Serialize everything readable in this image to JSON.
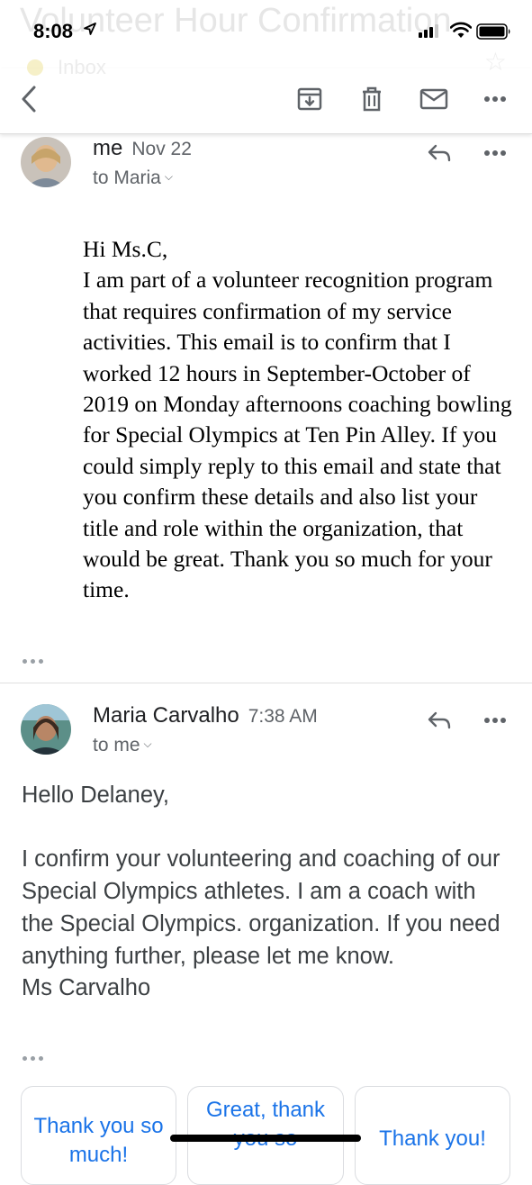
{
  "background_subject": "Volunteer Hour Confirmation",
  "background_label": "Inbox",
  "status_bar": {
    "time": "8:08"
  },
  "toolbar": {
    "back_icon": "back-arrow-icon",
    "archive_icon": "archive-icon",
    "delete_icon": "trash-icon",
    "mark_unread_icon": "mail-icon",
    "more_icon": "more-horizontal-icon"
  },
  "messages": [
    {
      "sender": "me",
      "date": "Nov 22",
      "to": "to Maria",
      "body": "Hi Ms.C,\nI am part of a volunteer recognition program that requires confirmation of my service activities. This email is to confirm that I worked 12 hours in September-October of 2019 on Monday afternoons coaching bowling for Special Olympics at Ten Pin Alley. If you could simply reply to this email and state that you confirm these details and also list your title and role within the organization, that would be great. Thank you so much for your time."
    },
    {
      "sender": "Maria Carvalho",
      "date": "7:38 AM",
      "to": "to me",
      "body": "Hello Delaney,\n\nI confirm your volunteering and coaching of our Special Olympics athletes. I am a coach with the Special Olympics. organization. If you need anything further, please let me know.\nMs Carvalho"
    }
  ],
  "smart_replies": [
    "Thank you so much!",
    "Great, thank you so",
    "Thank you!"
  ],
  "colors": {
    "link_blue": "#1a73e8",
    "secondary_text": "#5f6368",
    "divider": "#e0e0e0"
  }
}
